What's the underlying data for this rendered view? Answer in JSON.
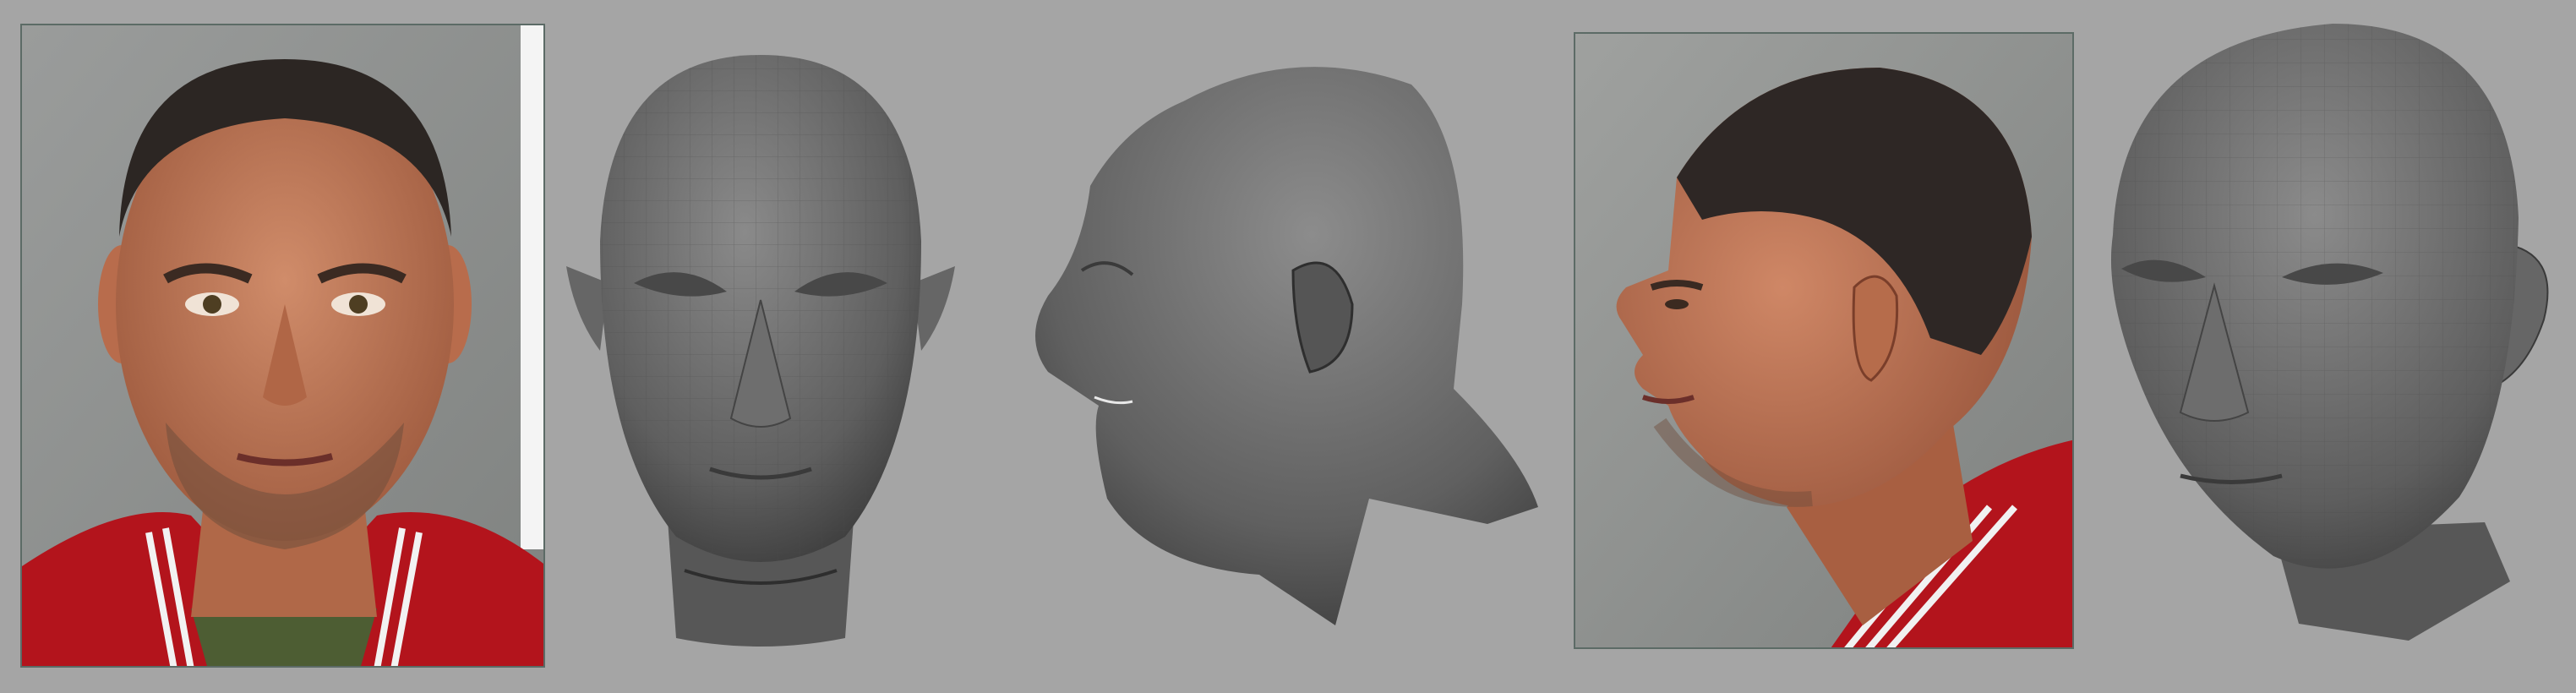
{
  "scene": {
    "background_color": "#a5a5a5",
    "panels": [
      {
        "id": "front-photo",
        "kind": "photograph",
        "view": "front"
      },
      {
        "id": "front-mesh",
        "kind": "3d-mesh-render",
        "view": "front"
      },
      {
        "id": "profile-mesh",
        "kind": "3d-mesh-render",
        "view": "left-profile"
      },
      {
        "id": "profile-photo",
        "kind": "photograph",
        "view": "left-profile"
      },
      {
        "id": "three-quarter-mesh",
        "kind": "3d-mesh-render",
        "view": "three-quarter"
      }
    ],
    "colors": {
      "mesh_shade": "#5f5f5f",
      "mesh_highlight": "#8a8a8a",
      "skin": "#c27a5a",
      "jacket": "#b3141c",
      "stone_wall": "#8f918f"
    }
  }
}
